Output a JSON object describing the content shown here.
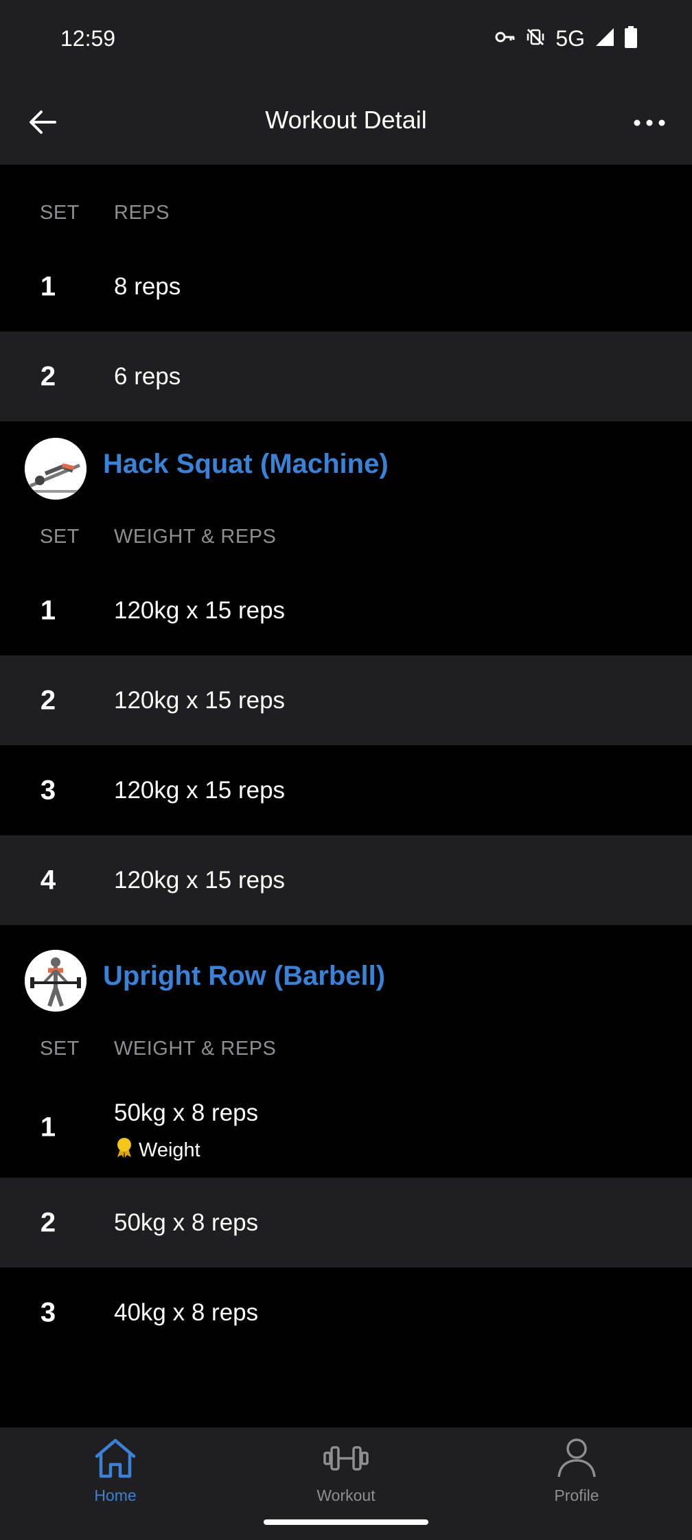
{
  "status_bar": {
    "time": "12:59",
    "network": "5G",
    "icons": [
      "vpn-key-icon",
      "vibrate-off-icon",
      "signal-icon",
      "battery-icon"
    ]
  },
  "app_bar": {
    "title": "Workout Detail",
    "back_icon": "arrow-left-icon",
    "more_icon": "more-horizontal-icon"
  },
  "first_block": {
    "columns": {
      "set": "SET",
      "value": "REPS"
    },
    "sets": [
      {
        "set": "1",
        "value": "8 reps"
      },
      {
        "set": "2",
        "value": "6 reps"
      }
    ]
  },
  "exercises": [
    {
      "name": "Hack Squat (Machine)",
      "columns": {
        "set": "SET",
        "value": "WEIGHT & REPS"
      },
      "sets": [
        {
          "set": "1",
          "value": "120kg x 15 reps"
        },
        {
          "set": "2",
          "value": "120kg x 15 reps"
        },
        {
          "set": "3",
          "value": "120kg x 15 reps"
        },
        {
          "set": "4",
          "value": "120kg x 15 reps"
        }
      ]
    },
    {
      "name": "Upright Row (Barbell)",
      "columns": {
        "set": "SET",
        "value": "WEIGHT & REPS"
      },
      "sets": [
        {
          "set": "1",
          "value": "50kg x 8 reps",
          "badge": "Weight"
        },
        {
          "set": "2",
          "value": "50kg x 8 reps"
        },
        {
          "set": "3",
          "value": "40kg x 8 reps"
        }
      ]
    }
  ],
  "bottom_nav": {
    "items": [
      {
        "label": "Home",
        "icon": "home-icon",
        "active": true
      },
      {
        "label": "Workout",
        "icon": "dumbbell-icon",
        "active": false
      },
      {
        "label": "Profile",
        "icon": "person-icon",
        "active": false
      }
    ]
  },
  "colors": {
    "accent": "#3b82d6",
    "bar_background": "#1f1f21",
    "background": "#000000",
    "muted_text": "#8e8e93",
    "badge_gold": "#f5c518"
  }
}
